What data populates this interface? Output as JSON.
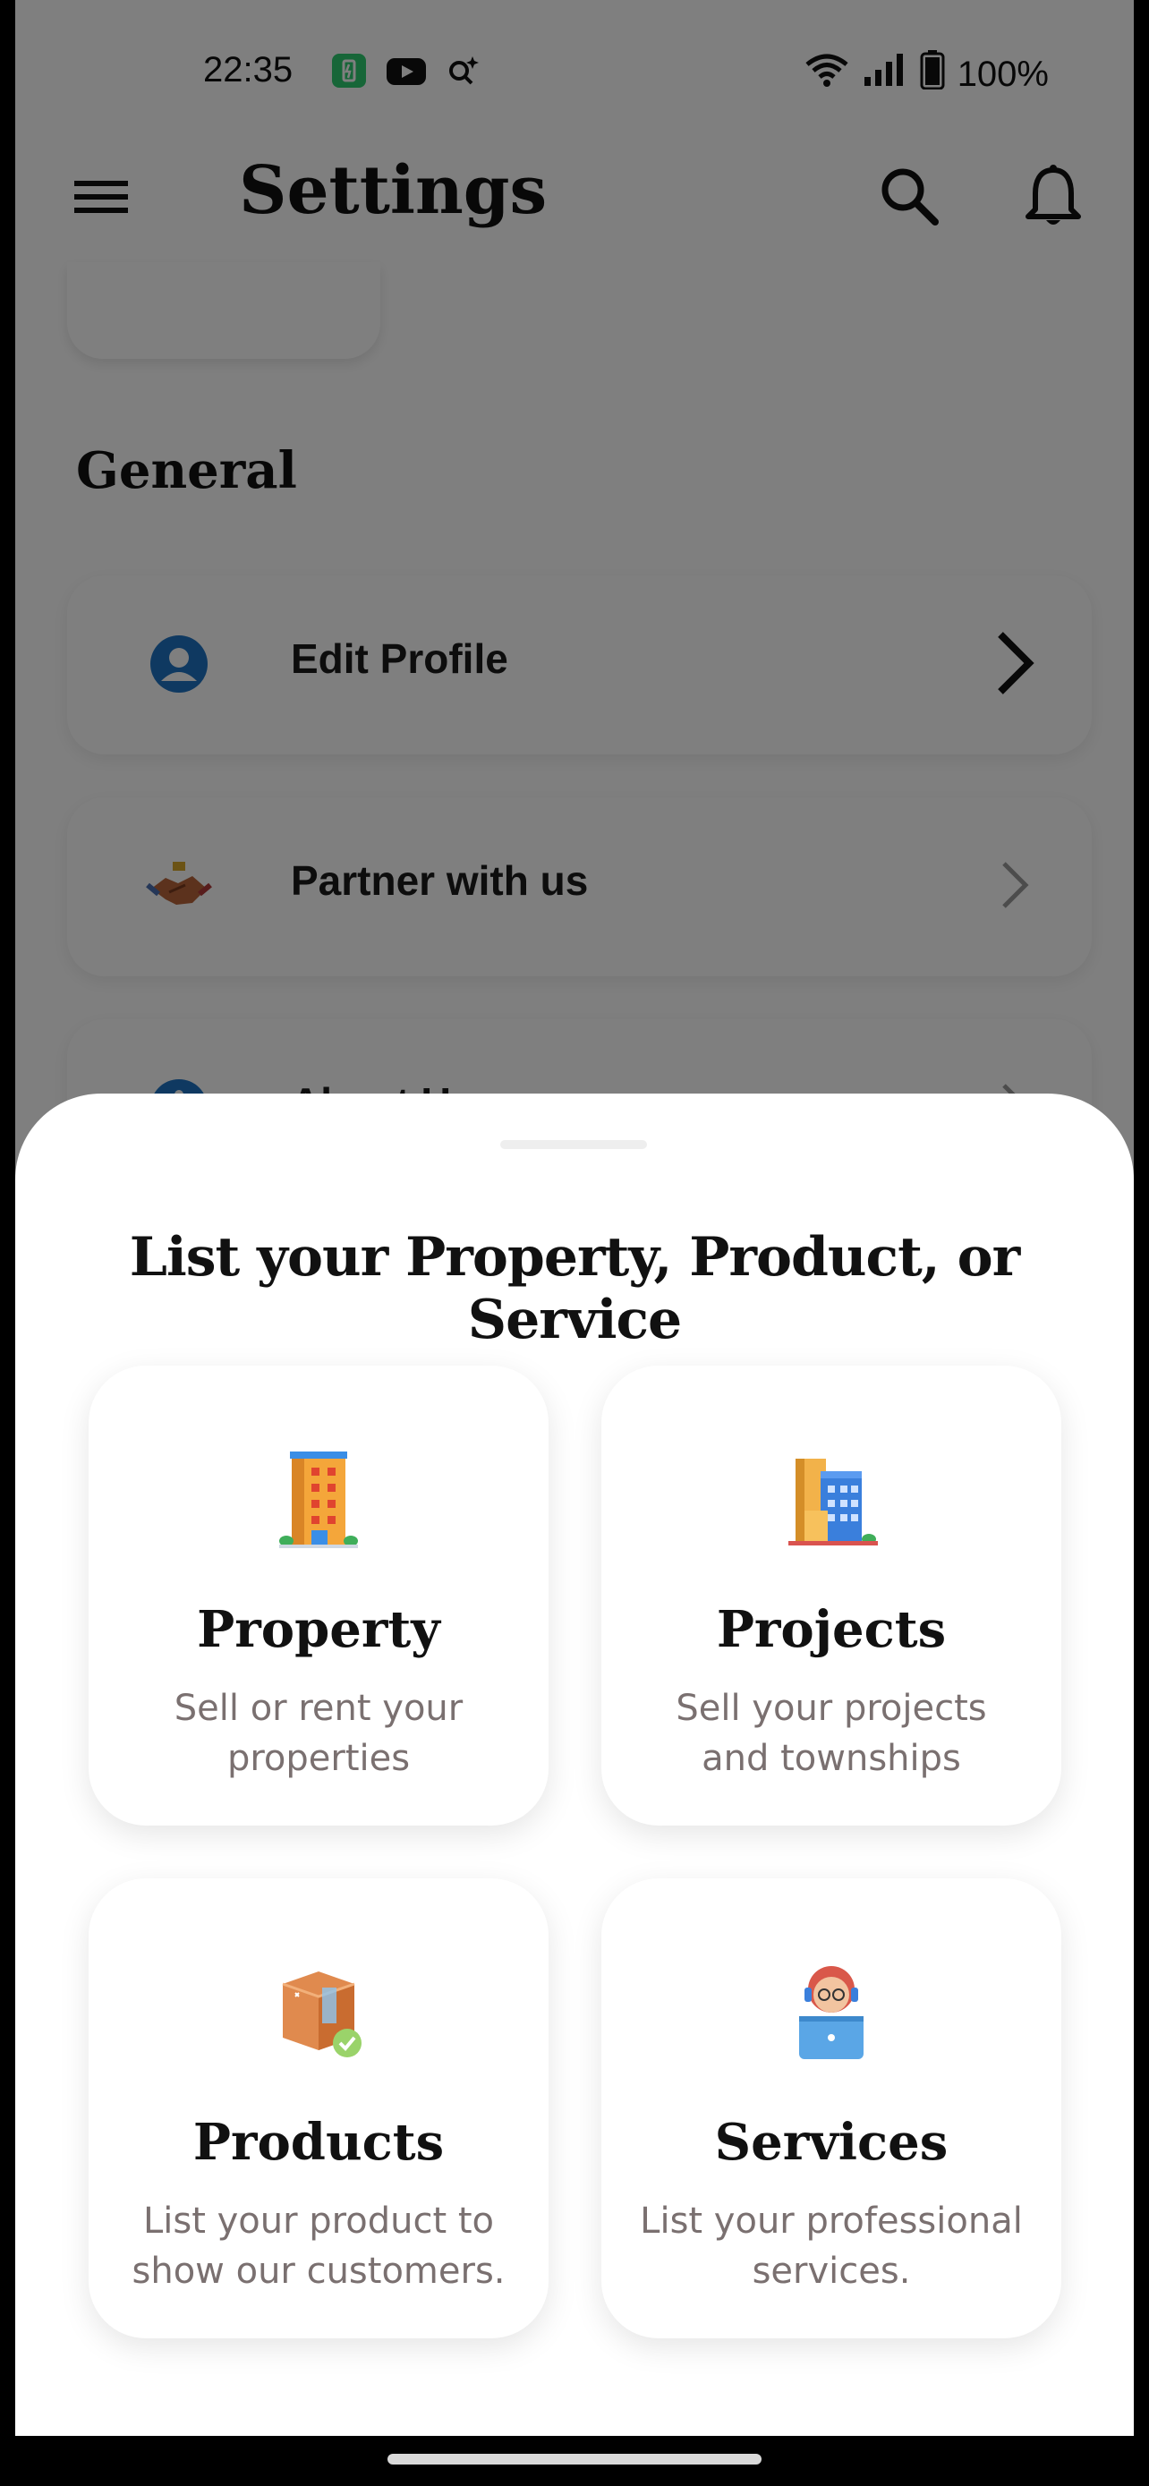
{
  "status_bar": {
    "time": "22:35",
    "battery": "100%",
    "icons": [
      "battery-saver-icon",
      "youtube-icon",
      "assistant-icon",
      "wifi-icon",
      "signal-icon",
      "battery-icon"
    ]
  },
  "toolbar": {
    "title": "Settings",
    "icons": [
      "menu-icon",
      "search-icon",
      "bell-icon"
    ]
  },
  "settings": {
    "section_title": "General",
    "items": [
      {
        "label": "Edit Profile",
        "icon": "user-icon"
      },
      {
        "label": "Partner with us",
        "icon": "handshake-icon"
      },
      {
        "label": "About Us",
        "icon": "info-icon"
      }
    ]
  },
  "sheet": {
    "title": "List your Property, Product, or Service",
    "tiles": [
      {
        "title": "Property",
        "desc": "Sell or rent your properties",
        "icon": "building-icon"
      },
      {
        "title": "Projects",
        "desc": "Sell your projects and townships",
        "icon": "buildings-icon"
      },
      {
        "title": "Products",
        "desc": "List your product to show our customers.",
        "icon": "package-icon"
      },
      {
        "title": "Services",
        "desc": "List your professional services.",
        "icon": "support-agent-icon"
      }
    ]
  },
  "colors": {
    "scrim": "#000000",
    "icon_blue": "#1E73C2",
    "muted_text": "#7a7070",
    "sheet_bg": "#ffffff"
  }
}
